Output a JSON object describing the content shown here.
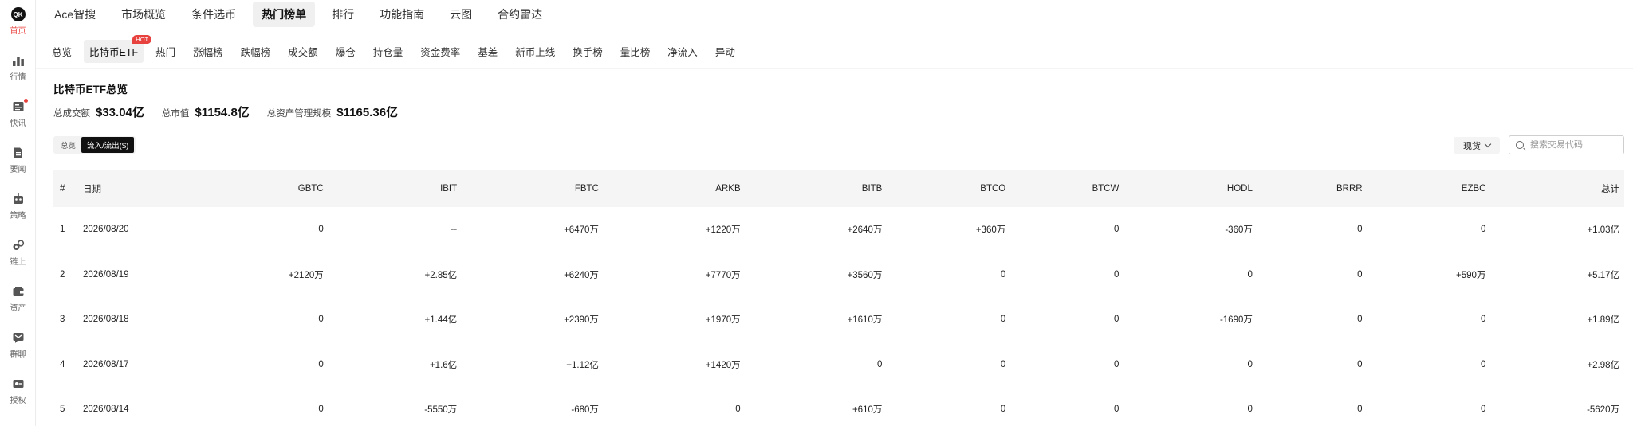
{
  "sidebar": {
    "items": [
      {
        "label": "首页",
        "icon": "logo-icon",
        "active": true
      },
      {
        "label": "行情",
        "icon": "bar-chart-icon"
      },
      {
        "label": "快讯",
        "icon": "news-icon"
      },
      {
        "label": "要闻",
        "icon": "document-icon"
      },
      {
        "label": "策略",
        "icon": "robot-icon"
      },
      {
        "label": "链上",
        "icon": "chain-icon"
      },
      {
        "label": "资产",
        "icon": "wallet-icon"
      },
      {
        "label": "群聊",
        "icon": "chat-icon"
      },
      {
        "label": "授权",
        "icon": "key-icon"
      }
    ],
    "logo_text": "QK"
  },
  "topnav": {
    "tabs": [
      "Ace智搜",
      "市场概览",
      "条件选币",
      "热门榜单",
      "排行",
      "功能指南",
      "云图",
      "合约雷达"
    ],
    "active": "热门榜单"
  },
  "subnav": {
    "tabs": [
      "总览",
      "比特币ETF",
      "热门",
      "涨幅榜",
      "跌幅榜",
      "成交额",
      "爆仓",
      "持仓量",
      "资金费率",
      "基差",
      "新币上线",
      "换手榜",
      "量比榜",
      "净流入",
      "异动"
    ],
    "active": "比特币ETF",
    "hot_badge": "HOT"
  },
  "overview": {
    "title": "比特币ETF总览",
    "stats": [
      {
        "label": "总成交额",
        "value": "$33.04亿"
      },
      {
        "label": "总市值",
        "value": "$1154.8亿"
      },
      {
        "label": "总资产管理规模",
        "value": "$1165.36亿"
      }
    ]
  },
  "controls": {
    "segments": [
      "总览",
      "流入/流出($)"
    ],
    "active_segment": "流入/流出($)",
    "spot_select": "现货",
    "search_placeholder": "搜索交易代码"
  },
  "colors": {
    "positive": "#12b27a",
    "negative": "#e8423f",
    "accent": "#e8423f"
  },
  "table": {
    "columns": [
      "#",
      "日期",
      "GBTC",
      "IBIT",
      "FBTC",
      "ARKB",
      "BITB",
      "BTCO",
      "BTCW",
      "HODL",
      "BRRR",
      "EZBC",
      "总计"
    ],
    "rows": [
      [
        "1",
        "2026/08/20",
        "0",
        "--",
        "+6470万",
        "+1220万",
        "+2640万",
        "+360万",
        "0",
        "-360万",
        "0",
        "0",
        "+1.03亿"
      ],
      [
        "2",
        "2026/08/19",
        "+2120万",
        "+2.85亿",
        "+6240万",
        "+7770万",
        "+3560万",
        "0",
        "0",
        "0",
        "0",
        "+590万",
        "+5.17亿"
      ],
      [
        "3",
        "2026/08/18",
        "0",
        "+1.44亿",
        "+2390万",
        "+1970万",
        "+1610万",
        "0",
        "0",
        "-1690万",
        "0",
        "0",
        "+1.89亿"
      ],
      [
        "4",
        "2026/08/17",
        "0",
        "+1.6亿",
        "+1.12亿",
        "+1420万",
        "0",
        "0",
        "0",
        "0",
        "0",
        "0",
        "+2.98亿"
      ],
      [
        "5",
        "2026/08/14",
        "0",
        "-5550万",
        "-680万",
        "0",
        "+610万",
        "0",
        "0",
        "0",
        "0",
        "0",
        "-5620万"
      ]
    ]
  }
}
